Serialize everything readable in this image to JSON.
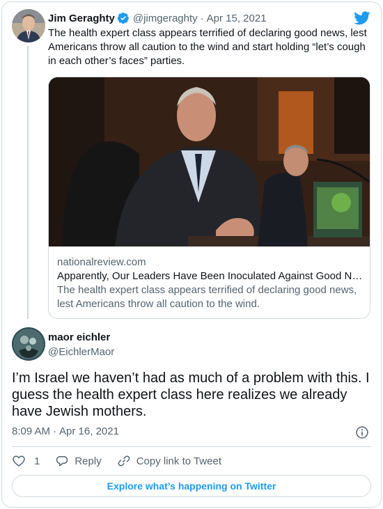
{
  "parent_tweet": {
    "author_name": "Jim Geraghty",
    "handle": "@jimgeraghty",
    "separator": "·",
    "date": "Apr 15, 2021",
    "verified": true,
    "text": "The health expert class appears terrified of declaring good news, lest Americans throw all caution to the wind and start holding “let’s cough in each other’s faces” parties.",
    "link_card": {
      "domain": "nationalreview.com",
      "title": "Apparently, Our Leaders Have Been Inoculated Against Good News",
      "description": "The health expert class appears terrified of declaring good news, lest Americans throw all caution to the wind."
    }
  },
  "reply_tweet": {
    "author_name": "maor eichler",
    "handle": "@EichlerMaor",
    "text": "I’m Israel we haven’t had as much of a problem with this. I guess the health expert class here realizes we already have Jewish mothers.",
    "time": "8:09 AM",
    "separator": "·",
    "date": "Apr 16, 2021"
  },
  "actions": {
    "like_count": "1",
    "reply_label": "Reply",
    "copy_link_label": "Copy link to Tweet"
  },
  "explore_label": "Explore what’s happening on Twitter",
  "colors": {
    "accent": "#1d9bf0",
    "text": "#0f1419",
    "secondary": "#536471",
    "border": "#cfd9de"
  },
  "icons": [
    "verified-badge-icon",
    "twitter-bird-icon",
    "info-icon",
    "heart-icon",
    "reply-icon",
    "link-icon"
  ]
}
